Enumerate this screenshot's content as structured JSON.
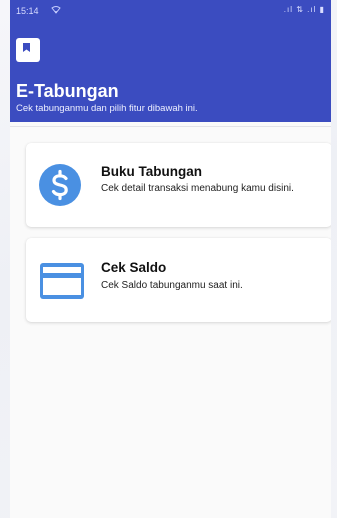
{
  "status_bar": {
    "time": "15:14",
    "wifi_icon": "wifi-icon",
    "right_icons": ".ıl ⇅ .ıl ▮"
  },
  "header": {
    "logo_icon": "bookmark-icon",
    "title": "E-Tabungan",
    "subtitle": "Cek tabunganmu dan pilih fitur dibawah ini."
  },
  "menu": [
    {
      "icon": "dollar-circle-icon",
      "title": "Buku Tabungan",
      "description": "Cek detail transaksi menabung kamu disini."
    },
    {
      "icon": "credit-card-icon",
      "title": "Cek Saldo",
      "description": "Cek Saldo tabunganmu saat ini."
    }
  ],
  "colors": {
    "primary": "#3b4cc0",
    "icon_blue": "#4a90e2",
    "background": "#fafafa"
  }
}
